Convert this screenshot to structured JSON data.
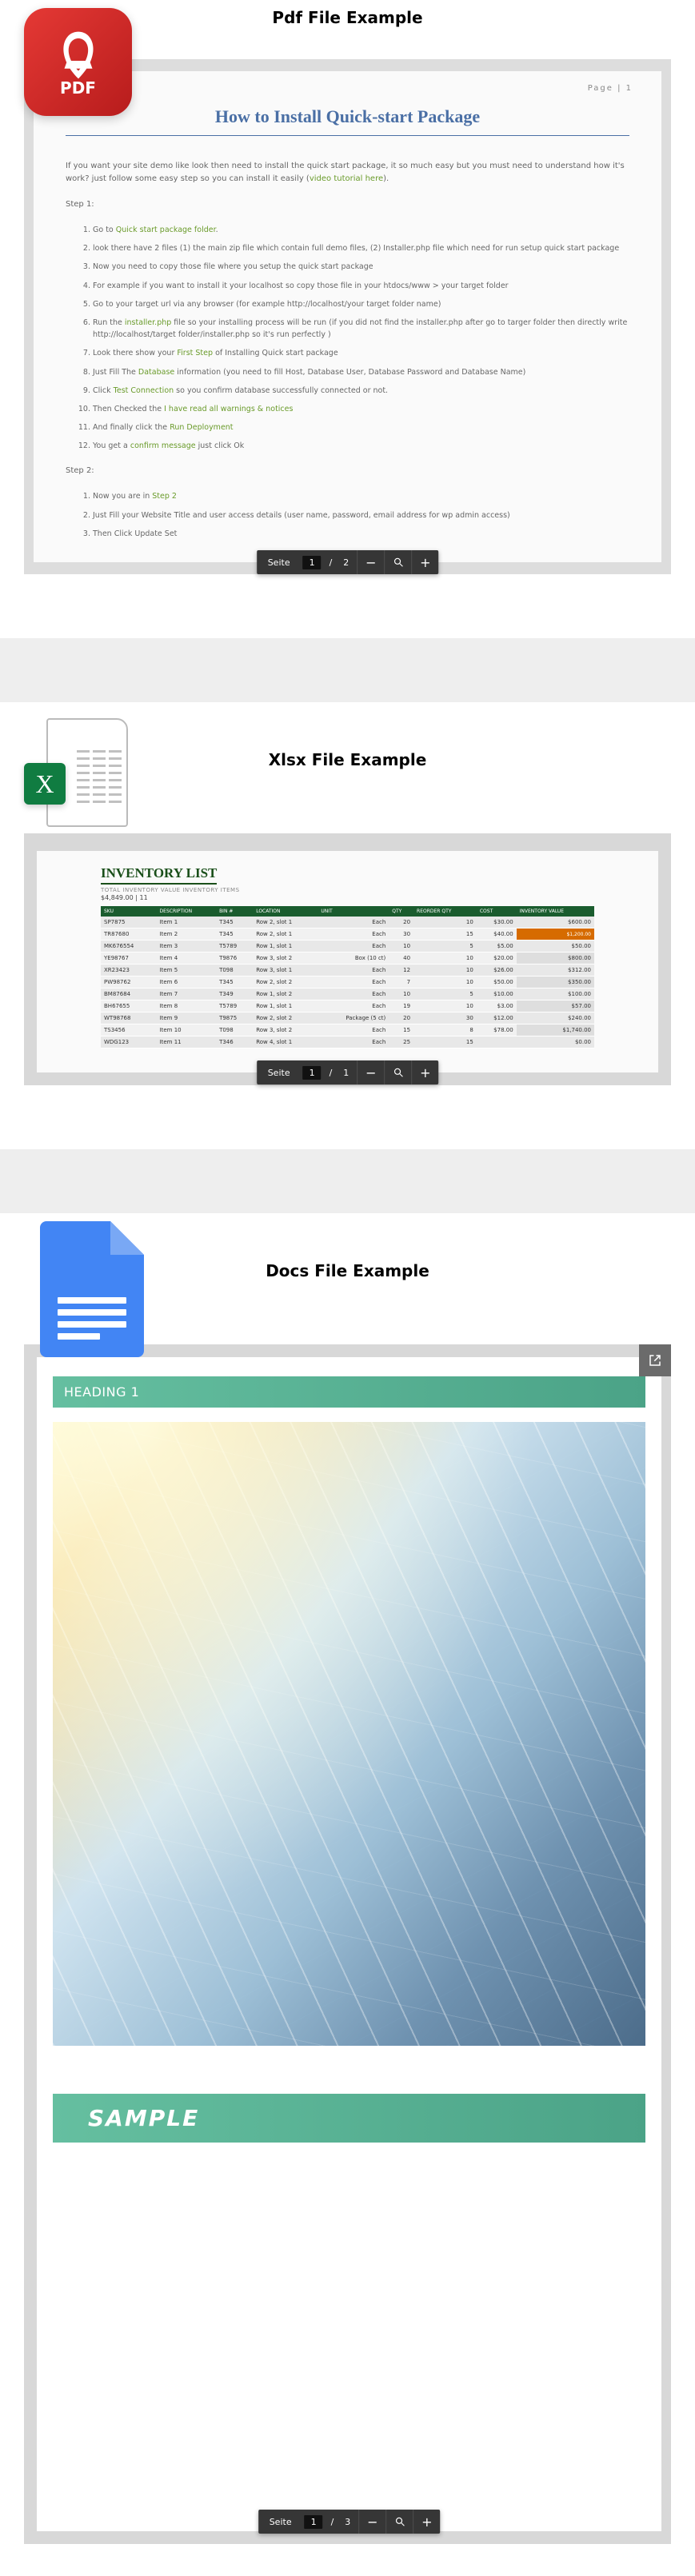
{
  "pdf": {
    "icon_label": "PDF",
    "section_title": "Pdf File Example",
    "page_label": "Page | 1",
    "heading": "How to Install Quick-start Package",
    "intro_a": "If you want your site demo like look then need to install the quick start package, it so much easy but you must need to understand how it's work? just follow some easy step so you can install it easily (",
    "intro_link": "video tutorial here",
    "intro_b": ").",
    "step1_label": "Step 1:",
    "step1": [
      {
        "pre": "Go to ",
        "link": "Quick start package folder",
        "post": "."
      },
      {
        "text": "look there have 2 files (1) the main zip file which contain full demo files, (2) Installer.php file which need for run setup quick start package"
      },
      {
        "text": "Now you need to copy those file where you setup the quick start package"
      },
      {
        "text": "For example if you want to install it your localhost so copy those file in your htdocs/www > your target folder"
      },
      {
        "text": "Go to your target url via any browser (for example http://localhost/your target folder name)"
      },
      {
        "pre": "Run the ",
        "link": "installer.php",
        "post": " file so your installing process will be run (if you did not find the installer.php after go to targer folder then directly write http://localhost/target folder/installer.php so it's run perfectly )"
      },
      {
        "pre": "Look there show your ",
        "link": "First Step",
        "post": " of Installing Quick start package"
      },
      {
        "pre": "Just Fill The ",
        "link": "Database",
        "post": " information (you need to fill Host, Database User, Database Password and Database Name)"
      },
      {
        "pre": "Click ",
        "link": "Test Connection",
        "post": " so you confirm database successfully connected or not."
      },
      {
        "pre": "Then Checked the ",
        "link": "I have read all warnings & notices",
        "post": ""
      },
      {
        "pre": "And finally click the ",
        "link": "Run Deployment",
        "post": ""
      },
      {
        "pre": "You get a ",
        "link": "confirm message",
        "post": " just click Ok"
      }
    ],
    "step2_label": "Step 2:",
    "step2": [
      {
        "pre": "Now you are in ",
        "link": "Step 2",
        "post": ""
      },
      {
        "text": "Just Fill your Website Title and user access details (user name, password, email address for wp admin access)"
      },
      {
        "text": "Then Click Update Set"
      }
    ],
    "pager": {
      "label": "Seite",
      "current": "1",
      "total": "2",
      "minus": "−",
      "zoom": "⚲",
      "plus": "+"
    }
  },
  "xlsx": {
    "badge": "X",
    "section_title": "Xlsx File Example",
    "inv_title": "INVENTORY LIST",
    "inv_sub": "TOTAL INVENTORY VALUE INVENTORY ITEMS",
    "inv_total": "$4,849.00 | 11",
    "headers": [
      "SKU",
      "DESCRIPTION",
      "BIN #",
      "LOCATION",
      "UNIT",
      "QTY",
      "REORDER QTY",
      "COST",
      "INVENTORY VALUE"
    ],
    "rows": [
      [
        "SP7875",
        "Item 1",
        "T345",
        "Row 2, slot 1",
        "Each",
        "20",
        "10",
        "$30.00",
        "$600.00"
      ],
      [
        "TR87680",
        "Item 2",
        "T345",
        "Row 2, slot 1",
        "Each",
        "30",
        "15",
        "$40.00",
        "$1,200.00"
      ],
      [
        "MK676554",
        "Item 3",
        "T5789",
        "Row 1, slot 1",
        "Each",
        "10",
        "5",
        "$5.00",
        "$50.00"
      ],
      [
        "YE98767",
        "Item 4",
        "T9876",
        "Row 3, slot 2",
        "Box (10 ct)",
        "40",
        "10",
        "$20.00",
        "$800.00"
      ],
      [
        "XR23423",
        "Item 5",
        "T098",
        "Row 3, slot 1",
        "Each",
        "12",
        "10",
        "$26.00",
        "$312.00"
      ],
      [
        "PW98762",
        "Item 6",
        "T345",
        "Row 2, slot 2",
        "Each",
        "7",
        "10",
        "$50.00",
        "$350.00"
      ],
      [
        "BM87684",
        "Item 7",
        "T349",
        "Row 1, slot 2",
        "Each",
        "10",
        "5",
        "$10.00",
        "$100.00"
      ],
      [
        "BH67655",
        "Item 8",
        "T5789",
        "Row 1, slot 1",
        "Each",
        "19",
        "10",
        "$3.00",
        "$57.00"
      ],
      [
        "WT98768",
        "Item 9",
        "T9875",
        "Row 2, slot 2",
        "Package (5 ct)",
        "20",
        "30",
        "$12.00",
        "$240.00"
      ],
      [
        "TS3456",
        "Item 10",
        "T098",
        "Row 3, slot 2",
        "Each",
        "15",
        "8",
        "$78.00",
        "$1,740.00"
      ],
      [
        "WDG123",
        "Item 11",
        "T346",
        "Row 4, slot 1",
        "Each",
        "25",
        "15",
        "",
        "$0.00"
      ]
    ],
    "hi_cell": "$1,200.00",
    "pager": {
      "label": "Seite",
      "current": "1",
      "total": "1",
      "minus": "−",
      "zoom": "⚲",
      "plus": "+"
    }
  },
  "docs": {
    "section_title": "Docs File Example",
    "heading1": "HEADING 1",
    "sample_text": "SAMPLE",
    "pager": {
      "label": "Seite",
      "current": "1",
      "total": "3",
      "minus": "−",
      "zoom": "⚲",
      "plus": "+"
    }
  }
}
